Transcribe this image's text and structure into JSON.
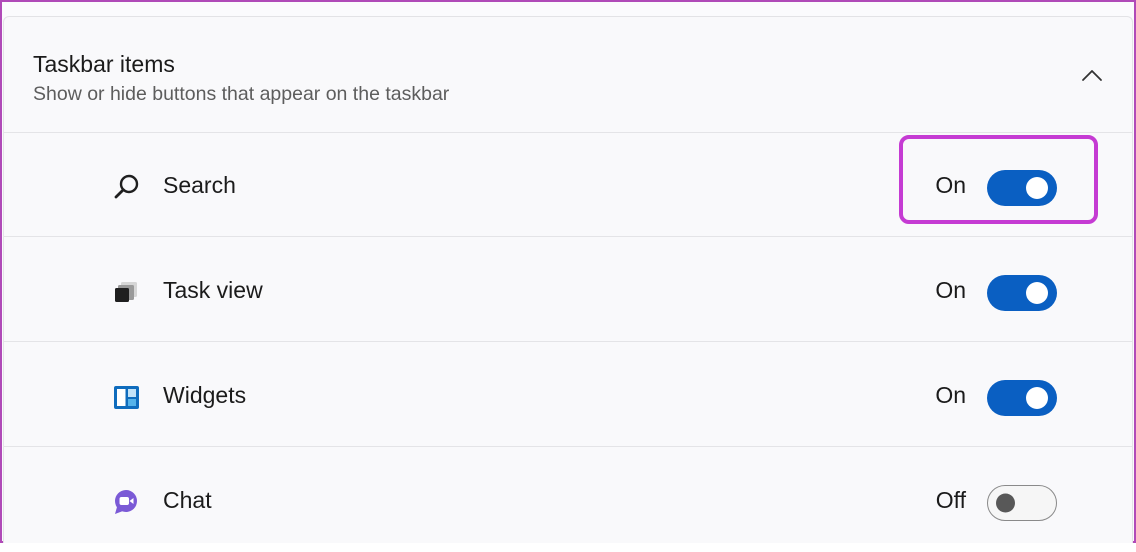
{
  "section": {
    "title": "Taskbar items",
    "subtitle": "Show or hide buttons that appear on the taskbar",
    "expanded": true,
    "collapse_icon": "chevron-up-icon"
  },
  "items": [
    {
      "label": "Search",
      "state_label": "On",
      "toggle_on": true,
      "icon": "search-icon"
    },
    {
      "label": "Task view",
      "state_label": "On",
      "toggle_on": true,
      "icon": "task-view-icon"
    },
    {
      "label": "Widgets",
      "state_label": "On",
      "toggle_on": true,
      "icon": "widgets-icon"
    },
    {
      "label": "Chat",
      "state_label": "Off",
      "toggle_on": false,
      "icon": "chat-icon"
    }
  ],
  "annotation": {
    "highlighted_item": "Search",
    "color": "#c53bd3"
  },
  "colors": {
    "accent": "#0a5fc2",
    "toggle_off_knob": "#585858"
  }
}
